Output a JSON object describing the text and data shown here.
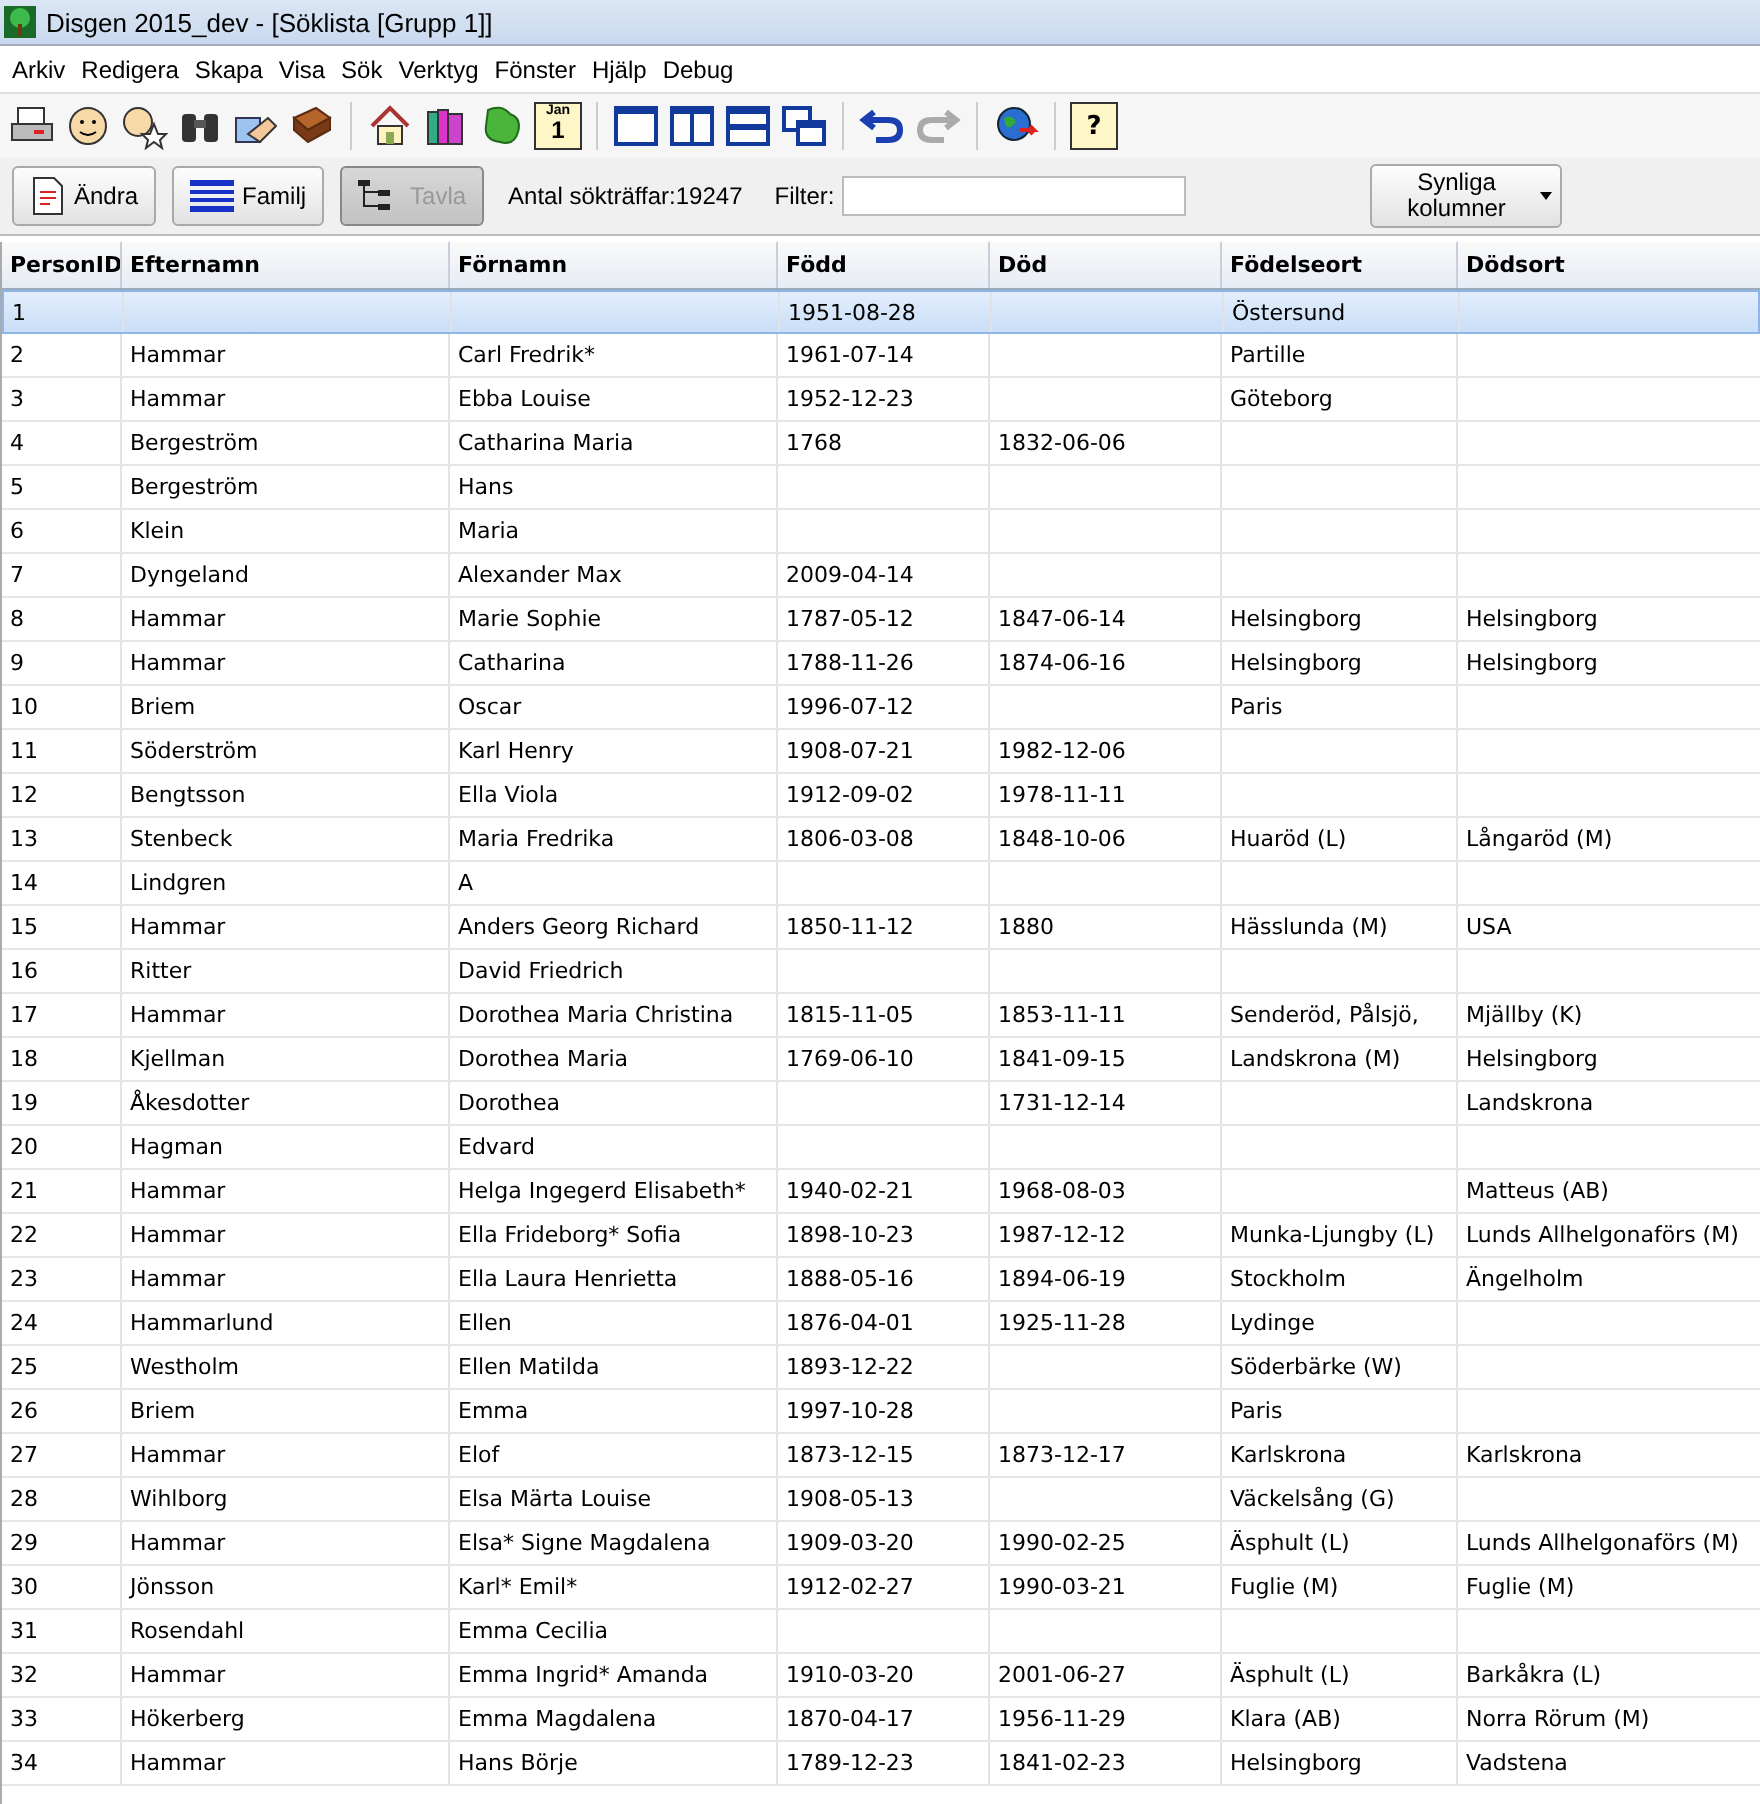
{
  "window": {
    "title": "Disgen 2015_dev - [Söklista [Grupp 1]]"
  },
  "menu": [
    "Arkiv",
    "Redigera",
    "Skapa",
    "Visa",
    "Sök",
    "Verktyg",
    "Fönster",
    "Hjälp",
    "Debug"
  ],
  "toolbar": {
    "calendar_month": "Jan",
    "calendar_day": "1",
    "help_glyph": "?"
  },
  "actions": [
    {
      "label": "Ändra",
      "kind": "edit",
      "disabled": false
    },
    {
      "label": "Familj",
      "kind": "family",
      "disabled": false
    },
    {
      "label": "Tavla",
      "kind": "tree",
      "disabled": true
    }
  ],
  "hits": {
    "label": "Antal sökträffar:",
    "value": "19247"
  },
  "filter": {
    "label": "Filter:"
  },
  "columns_button": {
    "label": "Synliga kolumner"
  },
  "table": {
    "columns": [
      "PersonID",
      "Efternamn",
      "Förnamn",
      "Född",
      "Död",
      "Födelseort",
      "Dödsort"
    ],
    "rows": [
      {
        "selected": true,
        "cells": [
          "1",
          "",
          "",
          "1951-08-28",
          "",
          "Östersund",
          ""
        ]
      },
      {
        "selected": false,
        "cells": [
          "2",
          "Hammar",
          "Carl Fredrik*",
          "1961-07-14",
          "",
          "Partille",
          ""
        ]
      },
      {
        "selected": false,
        "cells": [
          "3",
          "Hammar",
          "Ebba Louise",
          "1952-12-23",
          "",
          "Göteborg",
          ""
        ]
      },
      {
        "selected": false,
        "cells": [
          "4",
          "Bergeström",
          "Catharina Maria",
          "1768",
          "1832-06-06",
          "",
          ""
        ]
      },
      {
        "selected": false,
        "cells": [
          "5",
          "Bergeström",
          "Hans",
          "",
          "",
          "",
          ""
        ]
      },
      {
        "selected": false,
        "cells": [
          "6",
          "Klein",
          "Maria",
          "",
          "",
          "",
          ""
        ]
      },
      {
        "selected": false,
        "cells": [
          "7",
          "Dyngeland",
          "Alexander Max",
          "2009-04-14",
          "",
          "",
          ""
        ]
      },
      {
        "selected": false,
        "cells": [
          "8",
          "Hammar",
          "Marie Sophie",
          "1787-05-12",
          "1847-06-14",
          "Helsingborg",
          "Helsingborg"
        ]
      },
      {
        "selected": false,
        "cells": [
          "9",
          "Hammar",
          "Catharina",
          "1788-11-26",
          "1874-06-16",
          "Helsingborg",
          "Helsingborg"
        ]
      },
      {
        "selected": false,
        "cells": [
          "10",
          "Briem",
          "Oscar",
          "1996-07-12",
          "",
          "Paris",
          ""
        ]
      },
      {
        "selected": false,
        "cells": [
          "11",
          "Söderström",
          "Karl Henry",
          "1908-07-21",
          "1982-12-06",
          "",
          ""
        ]
      },
      {
        "selected": false,
        "cells": [
          "12",
          "Bengtsson",
          "Ella Viola",
          "1912-09-02",
          "1978-11-11",
          "",
          ""
        ]
      },
      {
        "selected": false,
        "cells": [
          "13",
          "Stenbeck",
          "Maria Fredrika",
          "1806-03-08",
          "1848-10-06",
          "Huaröd (L)",
          "Långaröd (M)"
        ]
      },
      {
        "selected": false,
        "cells": [
          "14",
          "Lindgren",
          "A",
          "",
          "",
          "",
          ""
        ]
      },
      {
        "selected": false,
        "cells": [
          "15",
          "Hammar",
          "Anders Georg Richard",
          "1850-11-12",
          "1880",
          "Hässlunda (M)",
          "USA"
        ]
      },
      {
        "selected": false,
        "cells": [
          "16",
          "Ritter",
          "David Friedrich",
          "",
          "",
          "",
          ""
        ]
      },
      {
        "selected": false,
        "cells": [
          "17",
          "Hammar",
          "Dorothea Maria Christina",
          "1815-11-05",
          "1853-11-11",
          "Senderöd, Pålsjö,",
          "Mjällby (K)"
        ]
      },
      {
        "selected": false,
        "cells": [
          "18",
          "Kjellman",
          "Dorothea Maria",
          "1769-06-10",
          "1841-09-15",
          "Landskrona (M)",
          "Helsingborg"
        ]
      },
      {
        "selected": false,
        "cells": [
          "19",
          "Åkesdotter",
          "Dorothea",
          "",
          "1731-12-14",
          "",
          "Landskrona"
        ]
      },
      {
        "selected": false,
        "cells": [
          "20",
          "Hagman",
          "Edvard",
          "",
          "",
          "",
          ""
        ]
      },
      {
        "selected": false,
        "cells": [
          "21",
          "Hammar",
          "Helga Ingegerd Elisabeth*",
          "1940-02-21",
          "1968-08-03",
          "",
          "Matteus (AB)"
        ]
      },
      {
        "selected": false,
        "cells": [
          "22",
          "Hammar",
          "Ella Frideborg* Sofia",
          "1898-10-23",
          "1987-12-12",
          "Munka-Ljungby (L)",
          "Lunds Allhelgonaförs (M)"
        ]
      },
      {
        "selected": false,
        "cells": [
          "23",
          "Hammar",
          "Ella Laura Henrietta",
          "1888-05-16",
          "1894-06-19",
          "Stockholm",
          "Ängelholm"
        ]
      },
      {
        "selected": false,
        "cells": [
          "24",
          "Hammarlund",
          "Ellen",
          "1876-04-01",
          "1925-11-28",
          "Lydinge",
          ""
        ]
      },
      {
        "selected": false,
        "cells": [
          "25",
          "Westholm",
          "Ellen Matilda",
          "1893-12-22",
          "",
          "Söderbärke (W)",
          ""
        ]
      },
      {
        "selected": false,
        "cells": [
          "26",
          "Briem",
          "Emma",
          "1997-10-28",
          "",
          "Paris",
          ""
        ]
      },
      {
        "selected": false,
        "cells": [
          "27",
          "Hammar",
          "Elof",
          "1873-12-15",
          "1873-12-17",
          "Karlskrona",
          "Karlskrona"
        ]
      },
      {
        "selected": false,
        "cells": [
          "28",
          "Wihlborg",
          "Elsa Märta Louise",
          "1908-05-13",
          "",
          "Väckelsång (G)",
          ""
        ]
      },
      {
        "selected": false,
        "cells": [
          "29",
          "Hammar",
          "Elsa* Signe Magdalena",
          "1909-03-20",
          "1990-02-25",
          "Äsphult (L)",
          "Lunds Allhelgonaförs (M)"
        ]
      },
      {
        "selected": false,
        "cells": [
          "30",
          "Jönsson",
          "Karl* Emil*",
          "1912-02-27",
          "1990-03-21",
          "Fuglie (M)",
          "Fuglie (M)"
        ]
      },
      {
        "selected": false,
        "cells": [
          "31",
          "Rosendahl",
          "Emma Cecilia",
          "",
          "",
          "",
          ""
        ]
      },
      {
        "selected": false,
        "cells": [
          "32",
          "Hammar",
          "Emma Ingrid* Amanda",
          "1910-03-20",
          "2001-06-27",
          "Äsphult (L)",
          "Barkåkra (L)"
        ]
      },
      {
        "selected": false,
        "cells": [
          "33",
          "Hökerberg",
          "Emma Magdalena",
          "1870-04-17",
          "1956-11-29",
          "Klara (AB)",
          "Norra Rörum (M)"
        ]
      },
      {
        "selected": false,
        "cells": [
          "34",
          "Hammar",
          "Hans Börje",
          "1789-12-23",
          "1841-02-23",
          "Helsingborg",
          "Vadstena"
        ]
      }
    ]
  }
}
